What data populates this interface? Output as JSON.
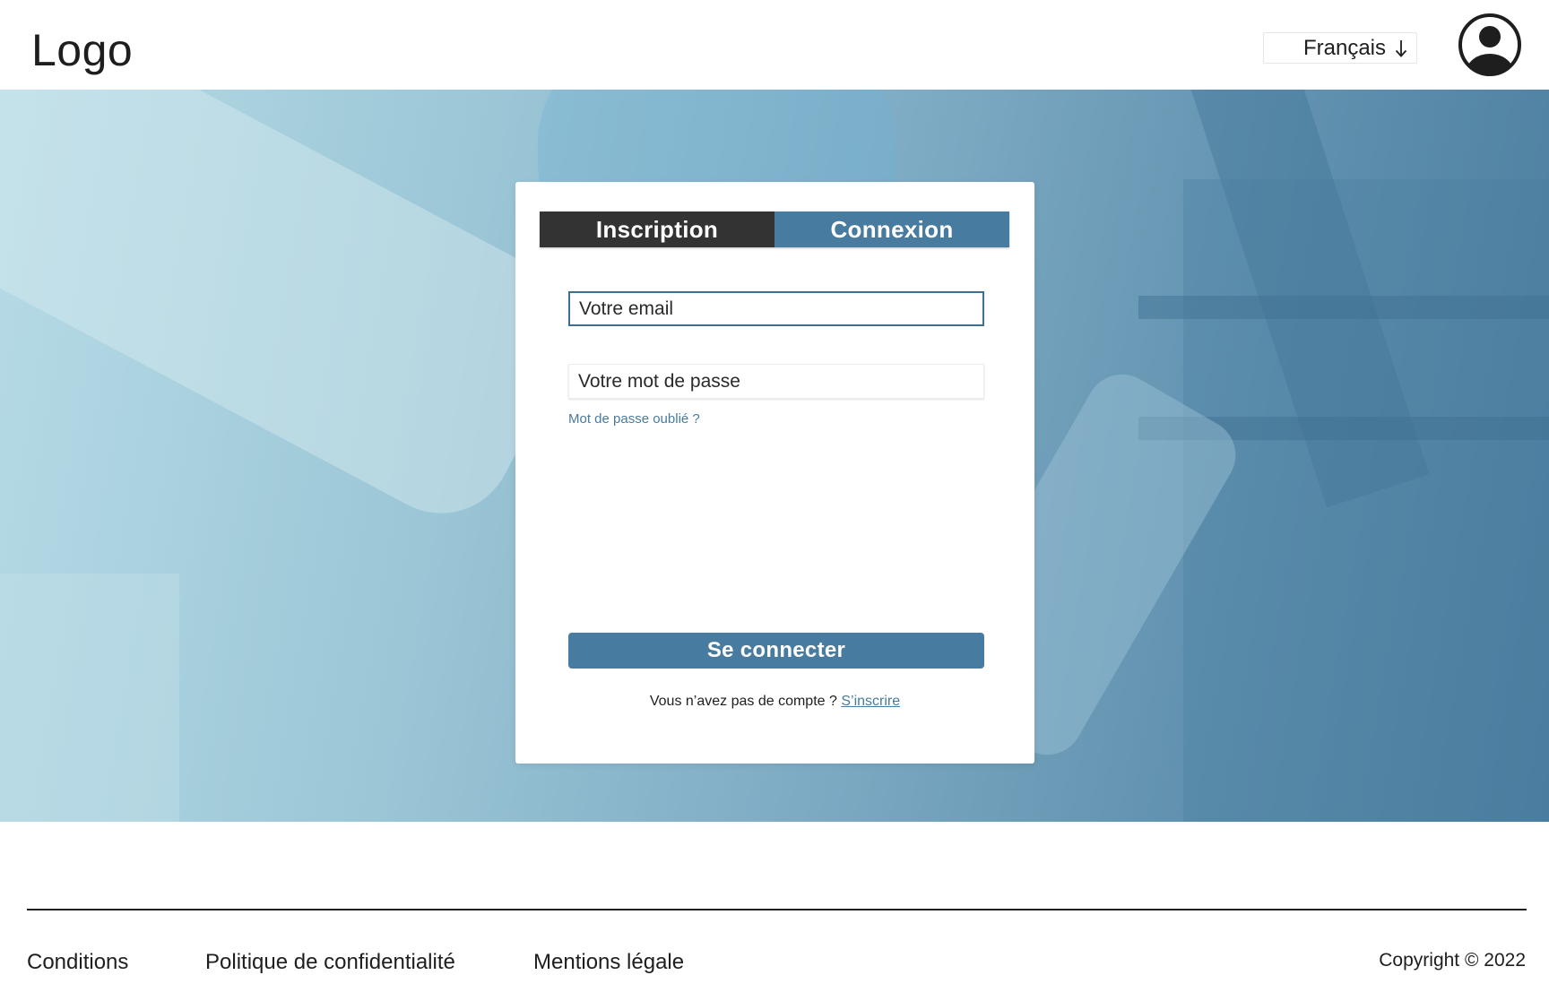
{
  "header": {
    "logo": "Logo",
    "language": {
      "selected": "Français"
    }
  },
  "auth": {
    "tabs": [
      {
        "label": "Inscription",
        "active": false
      },
      {
        "label": "Connexion",
        "active": true
      }
    ],
    "email_placeholder": "Votre email",
    "password_placeholder": "Votre mot de passe",
    "forgot_password": "Mot de passe oublié ?",
    "submit_label": "Se connecter",
    "no_account_text": "Vous n’avez pas de compte ?",
    "signup_link": "S’inscrire"
  },
  "footer": {
    "links": [
      "Conditions",
      "Politique de confidentialité",
      "Mentions légale"
    ],
    "copyright": "Copyright © 2022"
  },
  "colors": {
    "accent": "#477b9f",
    "dark_tab": "#333333",
    "text": "#1e1e1e"
  }
}
